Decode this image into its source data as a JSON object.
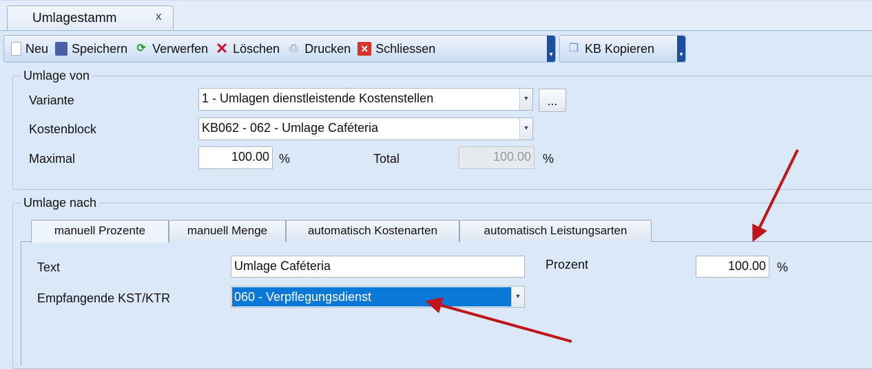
{
  "document_tab": {
    "title": "Umlagestamm",
    "close": "x"
  },
  "toolbar": {
    "items": [
      {
        "label": "Neu",
        "icon": "new-document-icon"
      },
      {
        "label": "Speichern",
        "icon": "save-icon"
      },
      {
        "label": "Verwerfen",
        "icon": "discard-icon"
      },
      {
        "label": "Löschen",
        "icon": "delete-icon"
      },
      {
        "label": "Drucken",
        "icon": "print-icon"
      },
      {
        "label": "Schliessen",
        "icon": "close-icon"
      }
    ],
    "kb_kopieren": "KB Kopieren"
  },
  "umlage_von": {
    "legend": "Umlage von",
    "variante_label": "Variante",
    "variante_value": "1 - Umlagen dienstleistende Kostenstellen",
    "browse": "...",
    "kostenblock_label": "Kostenblock",
    "kostenblock_value": "KB062 - 062 - Umlage Caféteria",
    "maximal_label": "Maximal",
    "maximal_value": "100.00",
    "pct": "%",
    "total_label": "Total",
    "total_value": "100.00"
  },
  "umlage_nach": {
    "legend": "Umlage nach",
    "tabs": [
      "manuell Prozente",
      "manuell Menge",
      "automatisch Kostenarten",
      "automatisch Leistungsarten"
    ],
    "text_label": "Text",
    "text_value": "Umlage Caféteria",
    "prozent_label": "Prozent",
    "prozent_value": "100.00",
    "pct": "%",
    "empf_label": "Empfangende KST/KTR",
    "empf_value": "060 - Verpflegungsdienst"
  },
  "colors": {
    "selection": "#0a78d7",
    "arrow": "#c0141a"
  }
}
